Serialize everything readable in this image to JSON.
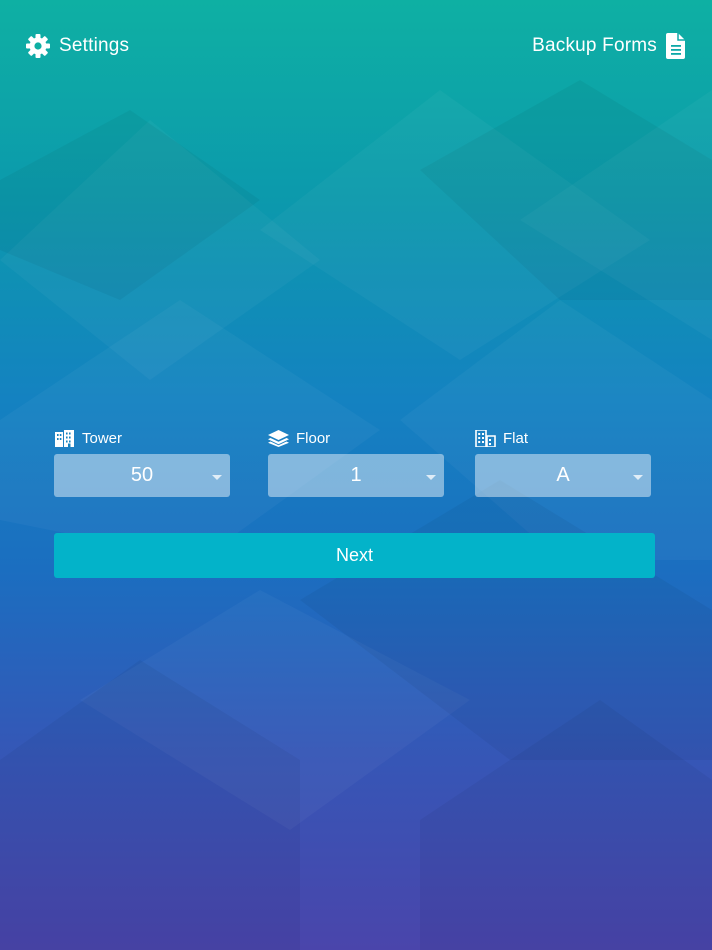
{
  "header": {
    "settings_label": "Settings",
    "settings_icon": "gear-icon",
    "backup_label": "Backup Forms",
    "backup_icon": "document-icon"
  },
  "selectors": {
    "tower": {
      "label": "Tower",
      "icon": "building-icon",
      "value": "50"
    },
    "floor": {
      "label": "Floor",
      "icon": "layers-icon",
      "value": "1"
    },
    "flat": {
      "label": "Flat",
      "icon": "apartment-icon",
      "value": "A"
    }
  },
  "actions": {
    "next_label": "Next"
  },
  "colors": {
    "gradient_top": "#0eb0a3",
    "gradient_mid": "#1482c1",
    "gradient_bottom": "#4a45ab",
    "button": "#03b3c9",
    "text": "#ffffff"
  }
}
